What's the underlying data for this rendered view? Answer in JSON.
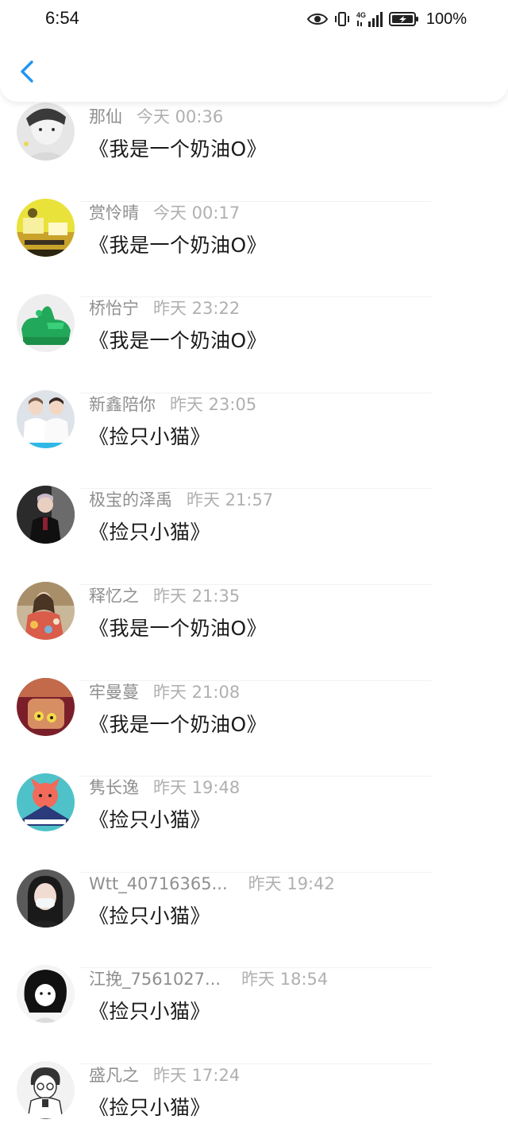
{
  "status_bar": {
    "time": "6:54",
    "network": "4G",
    "battery": "100%"
  },
  "nav": {
    "back_icon": "chevron-left-icon",
    "accent_color": "#2196F3"
  },
  "comments": [
    {
      "name": "那仙",
      "time": "今天 00:36",
      "text": "《我是一个奶油O》"
    },
    {
      "name": "赏怜晴",
      "time": "今天 00:17",
      "text": "《我是一个奶油O》"
    },
    {
      "name": "桥怡宁",
      "time": "昨天 23:22",
      "text": "《我是一个奶油O》"
    },
    {
      "name": "新鑫陪你",
      "time": "昨天 23:05",
      "text": "《捡只小猫》"
    },
    {
      "name": "极宝的泽禹",
      "time": "昨天 21:57",
      "text": "《捡只小猫》"
    },
    {
      "name": "释忆之",
      "time": "昨天 21:35",
      "text": "《我是一个奶油O》"
    },
    {
      "name": "牢曼蔓",
      "time": "昨天 21:08",
      "text": "《我是一个奶油O》"
    },
    {
      "name": "隽长逸",
      "time": "昨天 19:48",
      "text": "《捡只小猫》"
    },
    {
      "name": "Wtt_40716365...",
      "time": "昨天 19:42",
      "text": "《捡只小猫》"
    },
    {
      "name": "江挽_7561027...",
      "time": "昨天 18:54",
      "text": "《捡只小猫》"
    },
    {
      "name": "盛凡之",
      "time": "昨天 17:24",
      "text": "《捡只小猫》"
    }
  ]
}
